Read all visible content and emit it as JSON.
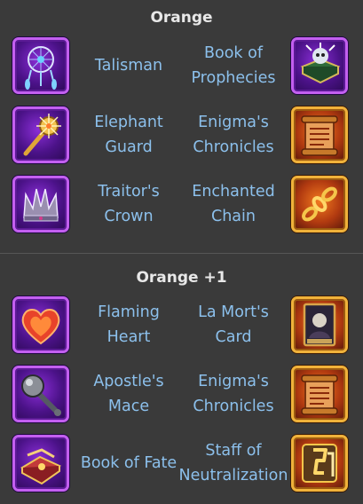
{
  "sections": [
    {
      "title": "Orange",
      "rows": [
        {
          "left": {
            "name": "Talisman",
            "icon": "dreamcatcher-icon"
          },
          "right": {
            "name": "Book of Prophecies",
            "icon": "prophecy-book-icon"
          }
        },
        {
          "left": {
            "name": "Elephant Guard",
            "icon": "golden-mace-icon"
          },
          "right": {
            "name": "Enigma's Chronicles",
            "icon": "scroll-icon"
          }
        },
        {
          "left": {
            "name": "Traitor's Crown",
            "icon": "crown-icon"
          },
          "right": {
            "name": "Enchanted Chain",
            "icon": "chain-icon"
          }
        }
      ]
    },
    {
      "title": "Orange +1",
      "rows": [
        {
          "left": {
            "name": "Flaming Heart",
            "icon": "heart-icon"
          },
          "right": {
            "name": "La Mort's Card",
            "icon": "card-icon"
          }
        },
        {
          "left": {
            "name": "Apostle's Mace",
            "icon": "spiked-mace-icon"
          },
          "right": {
            "name": "Enigma's Chronicles",
            "icon": "scroll-icon"
          }
        },
        {
          "left": {
            "name": "Book of Fate",
            "icon": "fate-book-icon"
          },
          "right": {
            "name": "Staff of Neutralization",
            "icon": "staff-icon"
          }
        }
      ]
    }
  ],
  "colors": {
    "background": "#3a3a3a",
    "title": "#e8e8e8",
    "item_name": "#8cc0ec",
    "purple_frame": "#c35ff0",
    "gold_frame": "#f0b23a"
  }
}
